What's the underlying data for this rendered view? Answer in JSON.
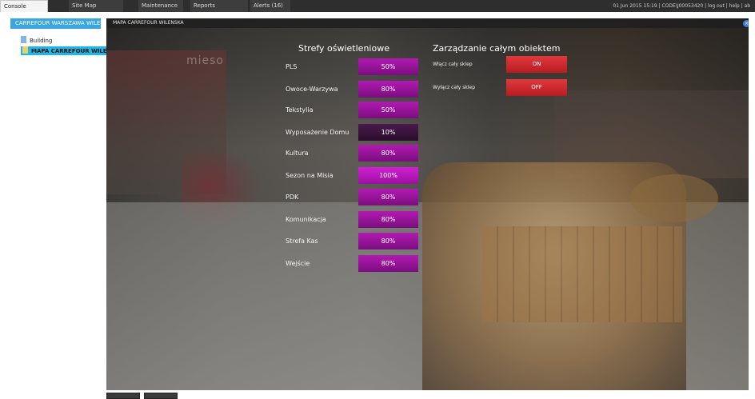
{
  "top_tabs": [
    {
      "label": "Console",
      "active": true
    },
    {
      "label": "Site Map",
      "active": false
    },
    {
      "label": "Maintenance",
      "active": false
    },
    {
      "label": "Reports",
      "active": false
    },
    {
      "label": "Alerts (16)",
      "active": false
    }
  ],
  "top_status": "01 Jun 2015 15:19 | CODE\\J00053420 | log out | help | ab",
  "sidebar": {
    "header": "CARREFOUR WARSZAWA WILENS",
    "items": [
      {
        "label": "Building",
        "selected": false,
        "icon": "building-icon"
      },
      {
        "label": "MAPA CARREFOUR WILENSKA",
        "selected": true,
        "icon": "map-icon"
      }
    ]
  },
  "map": {
    "title": "MAPA CARREFOUR WILENSKA",
    "close_icon": "close-icon",
    "lighting_title": "Strefy oświetleniowe",
    "management_title": "Zarządzanie całym obiektem",
    "zones": [
      {
        "label": "PLS",
        "value": "50%"
      },
      {
        "label": "Owoce-Warzywa",
        "value": "80%"
      },
      {
        "label": "Tekstylia",
        "value": "50%"
      },
      {
        "label": "Wyposażenie Domu",
        "value": "10%"
      },
      {
        "label": "Kultura",
        "value": "80%"
      },
      {
        "label": "Sezon na Misia",
        "value": "100%"
      },
      {
        "label": "PDK",
        "value": "80%"
      },
      {
        "label": "Komunikacja",
        "value": "80%"
      },
      {
        "label": "Strefa Kas",
        "value": "80%"
      },
      {
        "label": "Wejście",
        "value": "80%"
      }
    ],
    "controls": [
      {
        "label": "Włącz cały sklep",
        "button": "ON"
      },
      {
        "label": "Wyłącz cały sklep",
        "button": "OFF"
      }
    ],
    "background_sign": "mieso"
  },
  "colors": {
    "zone_button": "#9a159c",
    "control_button": "#d02a2f",
    "sidebar_header": "#3aa6df",
    "selected_item": "#1fb7e6"
  }
}
